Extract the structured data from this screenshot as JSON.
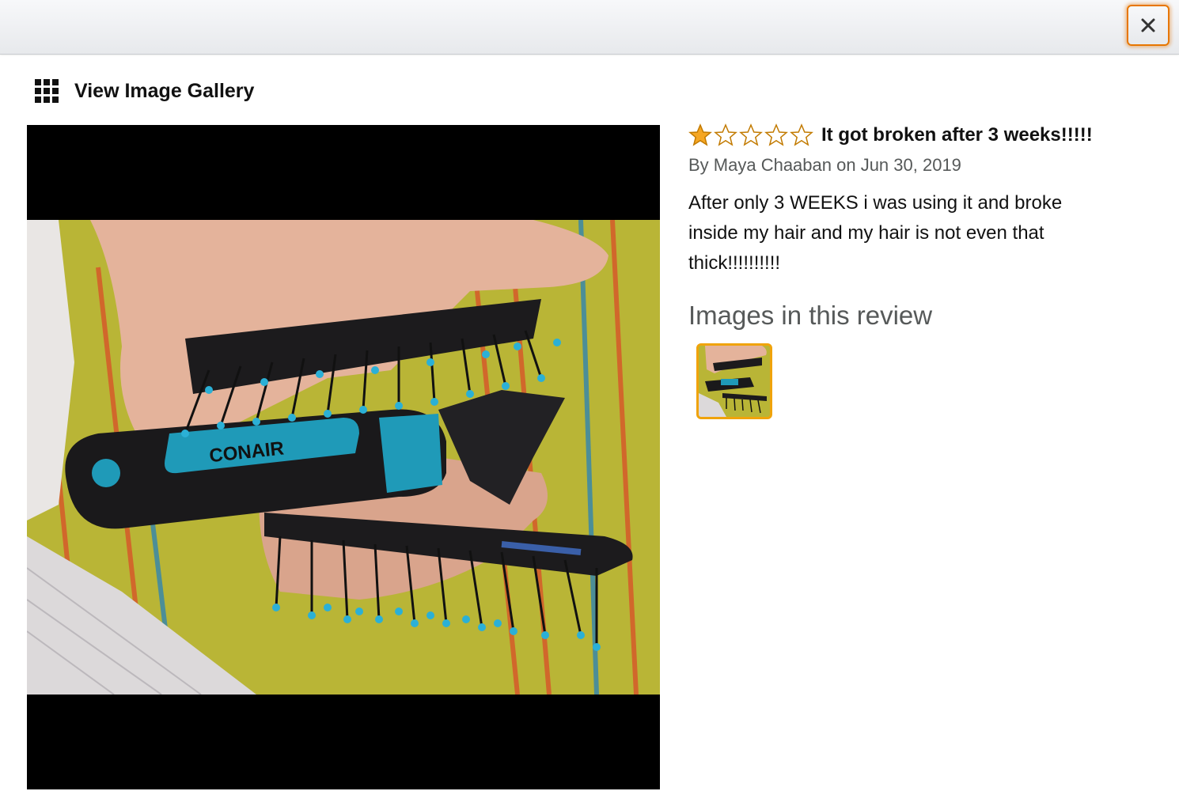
{
  "modal": {
    "close_label": "×"
  },
  "gallery": {
    "link_label": "View Image Gallery"
  },
  "review": {
    "rating": 1,
    "rating_max": 5,
    "title": "It got broken after 3 weeks!!!!!",
    "byline": "By Maya Chaaban on Jun 30, 2019",
    "body": "After only 3 WEEKS i was using it and broke inside my hair and my hair is not even that thick!!!!!!!!!!",
    "images_heading": "Images in this review"
  },
  "photo": {
    "brand_text": "CONAIR"
  },
  "colors": {
    "star_filled": "#f5a623",
    "star_outline": "#c27a00",
    "thumb_border": "#f0a30b",
    "close_border": "#e77600",
    "bristle_tip": "#2bb0d6"
  }
}
